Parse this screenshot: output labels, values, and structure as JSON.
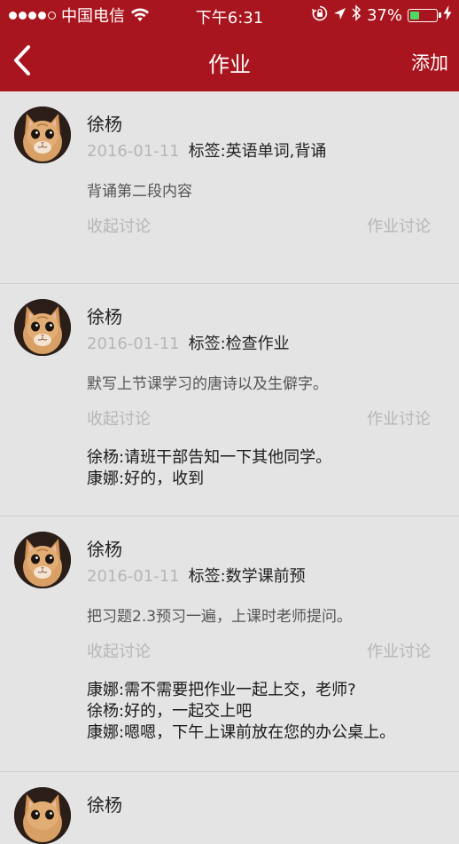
{
  "status_bar": {
    "carrier": "中国电信",
    "time": "下午6:31",
    "battery_percent_text": "37%",
    "battery_level": 0.37
  },
  "nav": {
    "title": "作业",
    "add_label": "添加"
  },
  "items": [
    {
      "author": "徐杨",
      "date": "2016-01-11",
      "tags": "标签:英语单词,背诵",
      "content": "背诵第二段内容",
      "collapse_label": "收起讨论",
      "discuss_label": "作业讨论",
      "comments": []
    },
    {
      "author": "徐杨",
      "date": "2016-01-11",
      "tags": "标签:检查作业",
      "content": "默写上节课学习的唐诗以及生僻字。",
      "collapse_label": "收起讨论",
      "discuss_label": "作业讨论",
      "comments": [
        "徐杨:请班干部告知一下其他同学。",
        "康娜:好的，收到"
      ]
    },
    {
      "author": "徐杨",
      "date": "2016-01-11",
      "tags": "标签:数学课前预",
      "content": "把习题2.3预习一遍，上课时老师提问。",
      "collapse_label": "收起讨论",
      "discuss_label": "作业讨论",
      "comments": [
        "康娜:需不需要把作业一起上交，老师?",
        "徐杨:好的，一起交上吧",
        "康娜:嗯嗯，下午上课前放在您的办公桌上。"
      ]
    },
    {
      "author": "徐杨"
    }
  ],
  "colors": {
    "header_red": "#a9151e",
    "background": "#e4e4e4",
    "muted_text": "#b6b6b6",
    "battery_green": "#4cd964"
  },
  "icons": {
    "back": "chevron-left-icon",
    "wifi": "wifi-icon",
    "lock_rotation": "rotation-lock-icon",
    "location": "location-arrow-icon",
    "bluetooth": "bluetooth-icon",
    "battery": "battery-icon",
    "charging": "charging-bolt-icon",
    "avatar": "cat-avatar"
  }
}
